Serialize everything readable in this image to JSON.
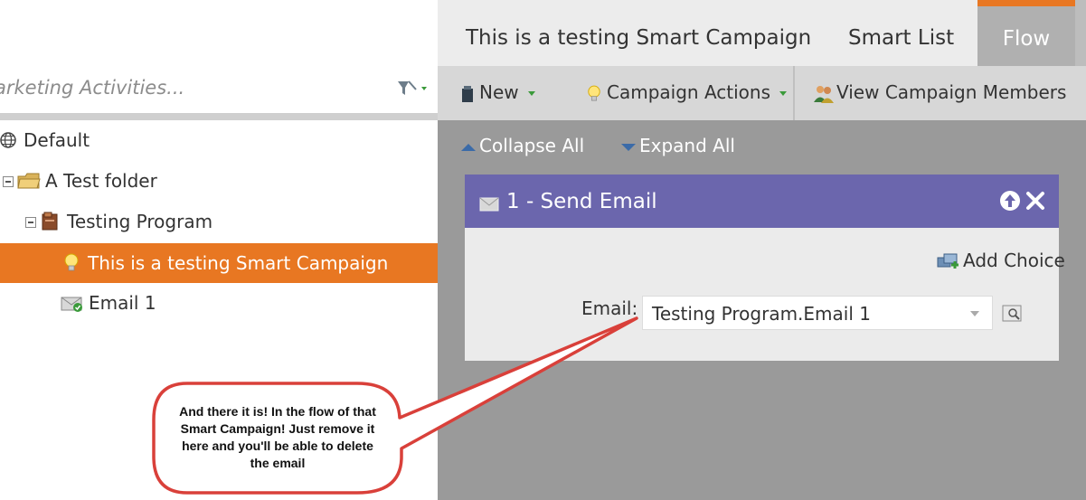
{
  "sidebar": {
    "search_placeholder": "arketing Activities...",
    "tree": [
      {
        "label": "Default",
        "icon": "globe-icon"
      },
      {
        "label": "A Test folder",
        "icon": "folder-icon"
      },
      {
        "label": "Testing Program",
        "icon": "program-icon"
      },
      {
        "label": "This is a testing Smart Campaign",
        "icon": "lightbulb-icon",
        "selected": true
      },
      {
        "label": "Email 1",
        "icon": "email-icon"
      }
    ]
  },
  "tabs": [
    {
      "label": "This is a testing Smart Campaign"
    },
    {
      "label": "Smart List"
    },
    {
      "label": "Flow",
      "active": true
    }
  ],
  "toolbar": {
    "new_label": "New",
    "campaign_actions_label": "Campaign Actions",
    "view_members_label": "View Campaign Members"
  },
  "flow": {
    "collapse_label": "Collapse All",
    "expand_label": "Expand All",
    "step": {
      "title": "1 - Send Email",
      "add_choice_label": "Add Choice",
      "email_field_label": "Email:",
      "email_value": "Testing Program.Email 1"
    }
  },
  "annotation": {
    "text": "And there it is! In the flow of that Smart Campaign! Just remove it here and you'll be able to delete the email"
  },
  "colors": {
    "accent_orange": "#e87722",
    "step_header": "#6b66ad",
    "callout_border": "#d9403a"
  }
}
